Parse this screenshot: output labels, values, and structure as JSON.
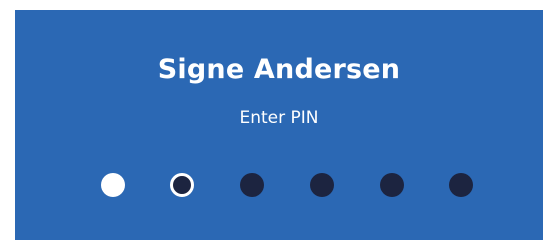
{
  "user": {
    "name": "Signe Andersen"
  },
  "prompt": "Enter PIN",
  "pin": {
    "length": 6,
    "entered": 1,
    "current_index": 1
  },
  "colors": {
    "background": "#2b68b4",
    "text": "#ffffff",
    "dot_filled": "#ffffff",
    "dot_empty": "#1c2440"
  }
}
